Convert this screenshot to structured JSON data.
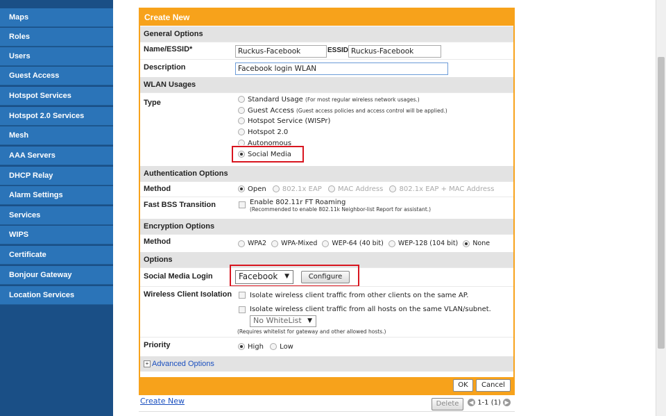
{
  "sidebar": {
    "items": [
      {
        "label": "Maps"
      },
      {
        "label": "Roles"
      },
      {
        "label": "Users"
      },
      {
        "label": "Guest Access"
      },
      {
        "label": "Hotspot Services"
      },
      {
        "label": "Hotspot 2.0 Services"
      },
      {
        "label": "Mesh"
      },
      {
        "label": "AAA Servers"
      },
      {
        "label": "DHCP Relay"
      },
      {
        "label": "Alarm Settings"
      },
      {
        "label": "Services"
      },
      {
        "label": "WIPS"
      },
      {
        "label": "Certificate"
      },
      {
        "label": "Bonjour Gateway"
      },
      {
        "label": "Location Services"
      }
    ]
  },
  "form": {
    "title": "Create New",
    "general": {
      "section": "General Options",
      "name_label": "Name/ESSID*",
      "name_value": "Ruckus-Facebook",
      "essid_label": "ESSID",
      "essid_value": "Ruckus-Facebook",
      "desc_label": "Description",
      "desc_value": "Facebook login WLAN"
    },
    "usages": {
      "section": "WLAN Usages",
      "type_label": "Type",
      "standard": "Standard Usage",
      "standard_note": "(For most regular wireless network usages.)",
      "guest": "Guest Access",
      "guest_note": "(Guest access policies and access control will be applied.)",
      "hotspot": "Hotspot Service (WISPr)",
      "hotspot20": "Hotspot 2.0",
      "autonomous": "Autonomous",
      "social": "Social Media"
    },
    "auth": {
      "section": "Authentication Options",
      "method_label": "Method",
      "open": "Open",
      "eap": "802.1x EAP",
      "mac": "MAC Address",
      "eap_mac": "802.1x EAP + MAC Address",
      "fbss_label": "Fast BSS Transition",
      "fbss_text": "Enable 802.11r FT Roaming",
      "fbss_note": "(Recommended to enable 802.11k Neighbor-list Report for assistant.)"
    },
    "enc": {
      "section": "Encryption Options",
      "method_label": "Method",
      "wpa2": "WPA2",
      "wpamixed": "WPA-Mixed",
      "wep64": "WEP-64 (40 bit)",
      "wep128": "WEP-128 (104 bit)",
      "none": "None"
    },
    "options": {
      "section": "Options",
      "social_label": "Social Media Login",
      "social_select": "Facebook",
      "configure": "Configure",
      "isolation_label": "Wireless Client Isolation",
      "iso1": "Isolate wireless client traffic from other clients on the same AP.",
      "iso2": "Isolate wireless client traffic from all hosts on the same VLAN/subnet.",
      "whitelist": "No WhiteList",
      "whitelist_note": "(Requires whitelist for gateway and other allowed hosts.)",
      "priority_label": "Priority",
      "high": "High",
      "low": "Low"
    },
    "advanced": "Advanced Options",
    "ok": "OK",
    "cancel": "Cancel"
  },
  "bottom": {
    "create_new": "Create New",
    "delete": "Delete",
    "paging": "1-1 (1)"
  },
  "colors": {
    "accent": "#f7a21b",
    "sidebar": "#2b74b8",
    "highlight": "#d8151f"
  }
}
